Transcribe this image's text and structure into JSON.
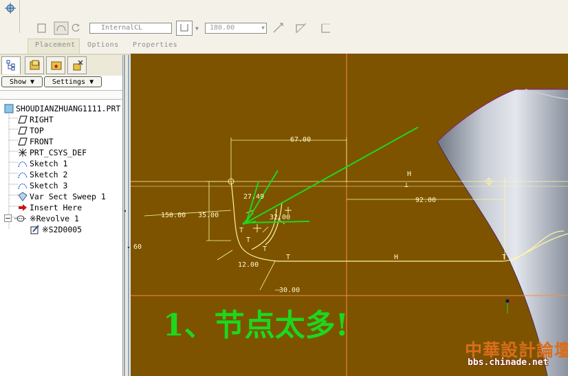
{
  "dashboard": {
    "placement_value": "InternalCL",
    "angle_value": "180.00",
    "tabs": [
      "Placement",
      "Options",
      "Properties"
    ]
  },
  "panel": {
    "show_label": "Show ▼",
    "settings_label": "Settings ▼"
  },
  "tree": [
    {
      "label": "SHOUDIANZHUANG1111.PRT",
      "icon": "part-icon"
    },
    {
      "label": "RIGHT",
      "icon": "datum-plane-icon"
    },
    {
      "label": "TOP",
      "icon": "datum-plane-icon"
    },
    {
      "label": "FRONT",
      "icon": "datum-plane-icon"
    },
    {
      "label": "PRT_CSYS_DEF",
      "icon": "csys-icon"
    },
    {
      "label": "Sketch 1",
      "icon": "sketch-icon"
    },
    {
      "label": "Sketch 2",
      "icon": "sketch-icon"
    },
    {
      "label": "Sketch 3",
      "icon": "sketch-icon"
    },
    {
      "label": "Var Sect Sweep 1",
      "icon": "sweep-icon"
    },
    {
      "label": "Insert Here",
      "icon": "insert-arrow-icon"
    },
    {
      "label": "※Revolve 1",
      "icon": "revolve-icon"
    },
    {
      "label": "※S2D0005",
      "icon": "section-icon"
    }
  ],
  "sketch": {
    "dims": {
      "d67": "67.00",
      "d92": "92.00",
      "d150": "150.00",
      "d35": "35.00",
      "d2749": "27.49",
      "d32": "32.00",
      "d12": "12.00",
      "d30": "30.00",
      "d60": "60"
    },
    "constraints": {
      "H1": "H",
      "H2": "H",
      "T": "T",
      "perp": "⊥"
    }
  },
  "annotation": "1、节点太多!",
  "watermark": {
    "title": "中華設計論壇",
    "url": "bbs.chinade.net"
  },
  "colors": {
    "graphics_bg": "#7d5300",
    "annotation": "#1cd81c",
    "sketch": "#fff8a0",
    "datum": "#ff8a3c"
  }
}
